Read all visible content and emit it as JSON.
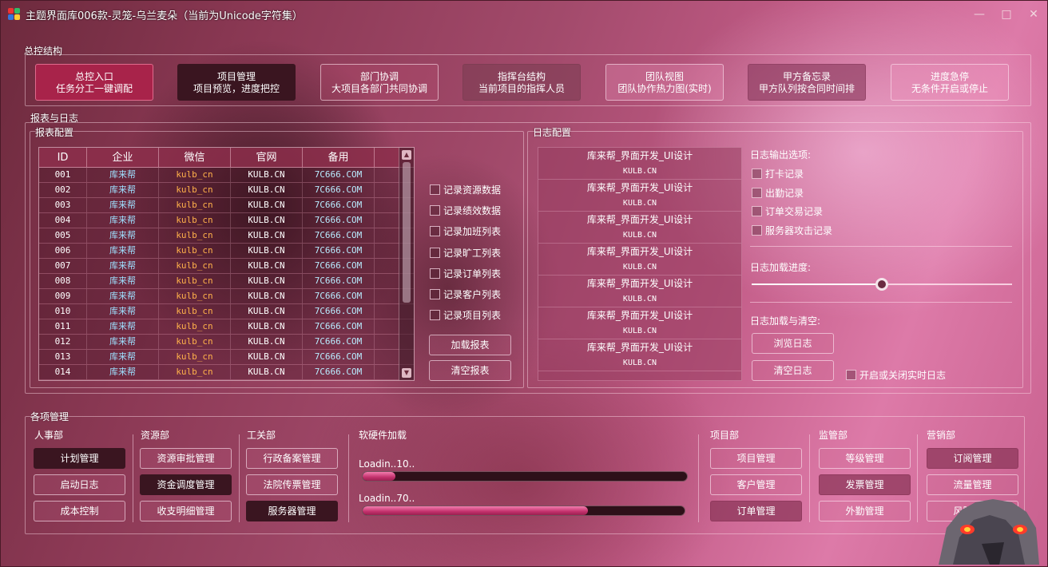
{
  "title": "主题界面库006款-灵笼-乌兰麦朵（当前为Unicode字符集）",
  "nav": {
    "group_title": "总控结构",
    "buttons": [
      {
        "line1": "总控入口",
        "line2": "任务分工一键调配"
      },
      {
        "line1": "项目管理",
        "line2": "项目预览，进度把控"
      },
      {
        "line1": "部门协调",
        "line2": "大项目各部门共同协调"
      },
      {
        "line1": "指挥台结构",
        "line2": "当前项目的指挥人员"
      },
      {
        "line1": "团队视图",
        "line2": "团队协作热力图(实时)"
      },
      {
        "line1": "甲方备忘录",
        "line2": "甲方队列按合同时间排"
      },
      {
        "line1": "进度急停",
        "line2": "无条件开启或停止"
      }
    ]
  },
  "reports": {
    "group_title": "报表与日志",
    "config_title": "报表配置",
    "columns": [
      "ID",
      "企业",
      "微信",
      "官网",
      "备用"
    ],
    "rows": [
      [
        "001",
        "库来帮",
        "kulb_cn",
        "KULB.CN",
        "7C666.COM"
      ],
      [
        "002",
        "库来帮",
        "kulb_cn",
        "KULB.CN",
        "7C666.COM"
      ],
      [
        "003",
        "库来帮",
        "kulb_cn",
        "KULB.CN",
        "7C666.COM"
      ],
      [
        "004",
        "库来帮",
        "kulb_cn",
        "KULB.CN",
        "7C666.COM"
      ],
      [
        "005",
        "库来帮",
        "kulb_cn",
        "KULB.CN",
        "7C666.COM"
      ],
      [
        "006",
        "库来帮",
        "kulb_cn",
        "KULB.CN",
        "7C666.COM"
      ],
      [
        "007",
        "库来帮",
        "kulb_cn",
        "KULB.CN",
        "7C666.COM"
      ],
      [
        "008",
        "库来帮",
        "kulb_cn",
        "KULB.CN",
        "7C666.COM"
      ],
      [
        "009",
        "库来帮",
        "kulb_cn",
        "KULB.CN",
        "7C666.COM"
      ],
      [
        "010",
        "库来帮",
        "kulb_cn",
        "KULB.CN",
        "7C666.COM"
      ],
      [
        "011",
        "库来帮",
        "kulb_cn",
        "KULB.CN",
        "7C666.COM"
      ],
      [
        "012",
        "库来帮",
        "kulb_cn",
        "KULB.CN",
        "7C666.COM"
      ],
      [
        "013",
        "库来帮",
        "kulb_cn",
        "KULB.CN",
        "7C666.COM"
      ],
      [
        "014",
        "库来帮",
        "kulb_cn",
        "KULB.CN",
        "7C666.COM"
      ]
    ],
    "checkboxes": [
      "记录资源数据",
      "记录绩效数据",
      "记录加班列表",
      "记录旷工列表",
      "记录订单列表",
      "记录客户列表",
      "记录项目列表"
    ],
    "load_button": "加载报表",
    "clear_button": "清空报表",
    "colors": {
      "company": "#9ee0ff",
      "wechat": "#ffb14a",
      "site": "#ffffff",
      "backup": "#b8ecff"
    }
  },
  "logs": {
    "config_title": "日志配置",
    "items": [
      {
        "main": "库来帮_界面开发_UI设计",
        "sub": "KULB.CN"
      },
      {
        "main": "库来帮_界面开发_UI设计",
        "sub": "KULB.CN"
      },
      {
        "main": "库来帮_界面开发_UI设计",
        "sub": "KULB.CN"
      },
      {
        "main": "库来帮_界面开发_UI设计",
        "sub": "KULB.CN"
      },
      {
        "main": "库来帮_界面开发_UI设计",
        "sub": "KULB.CN"
      },
      {
        "main": "库来帮_界面开发_UI设计",
        "sub": "KULB.CN"
      },
      {
        "main": "库来帮_界面开发_UI设计",
        "sub": "KULB.CN"
      }
    ],
    "output_label": "日志输出选项:",
    "options": [
      "打卡记录",
      "出勤记录",
      "订单交易记录",
      "服务器攻击记录"
    ],
    "progress_label": "日志加载进度:",
    "progress_fraction": 0.5,
    "load_clear_label": "日志加载与清空:",
    "browse_button": "浏览日志",
    "clear_button": "清空日志",
    "realtime_checkbox": "开启或关闭实时日志"
  },
  "management": {
    "group_title": "各项管理",
    "hr": {
      "title": "人事部",
      "buttons": [
        "计划管理",
        "启动日志",
        "成本控制"
      ]
    },
    "resources": {
      "title": "资源部",
      "buttons": [
        "资源审批管理",
        "资金调度管理",
        "收支明细管理"
      ]
    },
    "industry": {
      "title": "工关部",
      "buttons": [
        "行政备案管理",
        "法院传票管理",
        "服务器管理"
      ]
    },
    "loading": {
      "title": "软硬件加载",
      "bars": [
        {
          "label": "Loadin..10..",
          "fraction": 0.1
        },
        {
          "label": "Loadin..70..",
          "fraction": 0.7
        }
      ]
    },
    "projects": {
      "title": "项目部",
      "buttons": [
        "项目管理",
        "客户管理",
        "订单管理"
      ]
    },
    "supervision": {
      "title": "监管部",
      "buttons": [
        "等级管理",
        "发票管理",
        "外勤管理"
      ]
    },
    "marketing": {
      "title": "营销部",
      "buttons": [
        "订阅管理",
        "流量管理",
        "风险管理"
      ]
    }
  }
}
